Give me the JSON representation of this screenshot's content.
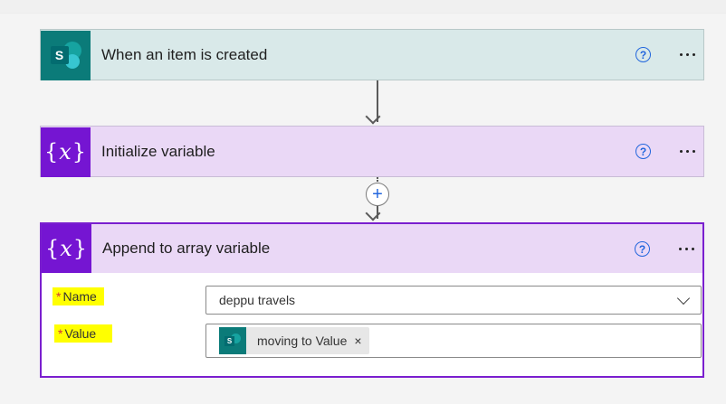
{
  "flow": {
    "trigger": {
      "title": "When an item is created",
      "icon": "sharepoint-icon",
      "help_symbol": "?",
      "accent": "#0b7b79"
    },
    "init_variable": {
      "title": "Initialize variable",
      "icon": "variable-icon",
      "help_symbol": "?",
      "accent": "#7515d2"
    },
    "insert_step": {
      "symbol": "+"
    },
    "append_variable": {
      "title": "Append to array variable",
      "icon": "variable-icon",
      "help_symbol": "?",
      "accent": "#7515d2",
      "fields": {
        "name": {
          "required_mark": "*",
          "label": "Name",
          "selected_value": "deppu travels"
        },
        "value": {
          "required_mark": "*",
          "label": "Value",
          "token": {
            "label": "moving to Value",
            "remove_symbol": "×",
            "icon": "sharepoint-icon"
          }
        }
      }
    }
  },
  "icons": {
    "sharepoint_letter": "S",
    "variable_glyph_open": "{",
    "variable_glyph_x": "x",
    "variable_glyph_close": "}"
  },
  "colors": {
    "trigger_header_bg": "#d9e9e9",
    "action_header_bg": "#ead8f6",
    "selected_border": "#7a1fcf",
    "highlight": "#ffff00",
    "link_blue": "#2266dd"
  }
}
